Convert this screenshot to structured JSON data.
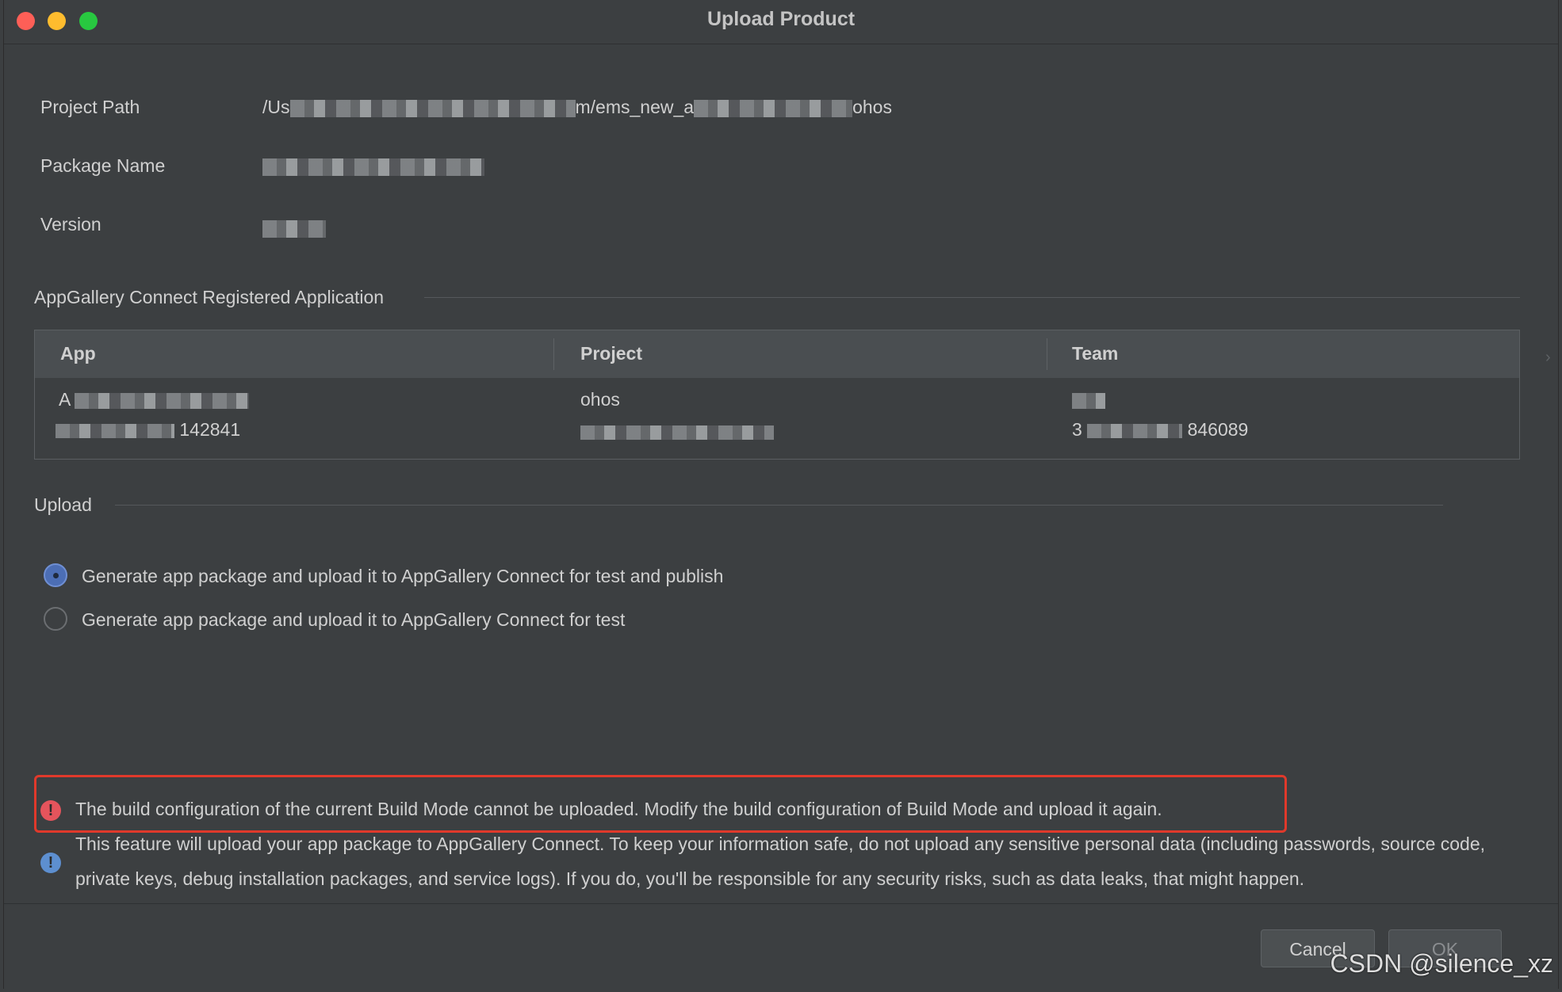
{
  "window": {
    "title": "Upload Product"
  },
  "fields": {
    "project_path_label": "Project Path",
    "project_path_value_start": "/Us",
    "project_path_value_mid": "m/ems_new_a",
    "project_path_value_end": "ohos",
    "package_name_label": "Package Name",
    "version_label": "Version"
  },
  "registered_app": {
    "section_title": "AppGallery Connect Registered Application",
    "columns": [
      "App",
      "Project",
      "Team"
    ],
    "row": {
      "app_line1": "A",
      "app_line2": "142841",
      "project_line1": "ohos",
      "team_line2_start": "3",
      "team_line2_end": "846089"
    }
  },
  "upload": {
    "section_title": "Upload",
    "options": [
      {
        "label": "Generate app package and upload it to AppGallery Connect for test and publish",
        "selected": true
      },
      {
        "label": "Generate app package and upload it to AppGallery Connect for test",
        "selected": false
      }
    ]
  },
  "messages": {
    "error": "The build configuration of the current Build Mode cannot be uploaded. Modify the build configuration of Build Mode and upload it again.",
    "info": "This feature will upload your app package to AppGallery Connect. To keep your information safe, do not upload any sensitive personal data (including passwords, source code, private keys, debug installation packages, and service logs). If you do, you'll be responsible for any security risks, such as data leaks, that might happen.",
    "error_icon_glyph": "!",
    "info_icon_glyph": "!"
  },
  "buttons": {
    "cancel": "Cancel",
    "ok": "OK"
  },
  "watermark": "CSDN @silence_xz",
  "colors": {
    "background": "#3c3f41",
    "error_border": "#e0392b",
    "radio_selected": "#4c6eb5",
    "error_icon": "#e5545c",
    "info_icon": "#5d8fd0"
  },
  "icons": {
    "error": "error-icon",
    "info": "info-icon"
  }
}
